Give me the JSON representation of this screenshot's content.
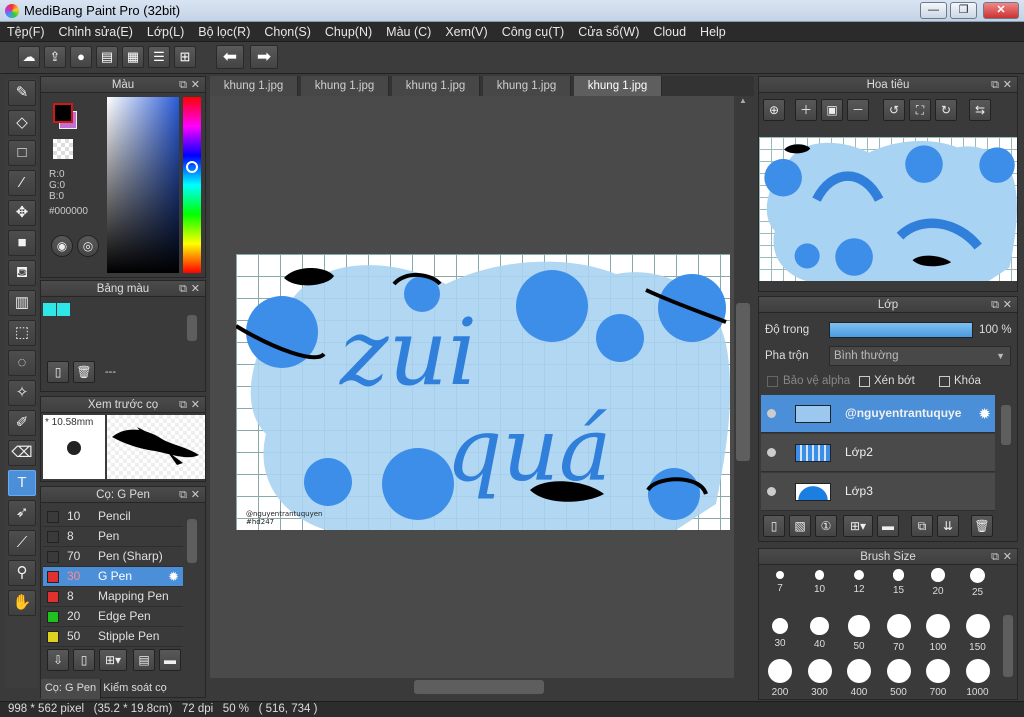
{
  "window": {
    "title": "MediBang Paint Pro (32bit)",
    "minimize": "—",
    "restore": "❐",
    "close": "✕"
  },
  "menu": [
    "Tệp(F)",
    "Chỉnh sửa(E)",
    "Lớp(L)",
    "Bộ lọc(R)",
    "Chọn(S)",
    "Chụp(N)",
    "Màu (C)",
    "Xem(V)",
    "Công cụ(T)",
    "Cửa sổ(W)",
    "Cloud",
    "Help"
  ],
  "tabs": [
    "khung 1.jpg",
    "khung 1.jpg",
    "khung 1.jpg",
    "khung 1.jpg",
    "khung 1.jpg"
  ],
  "active_tab": 4,
  "color_panel": {
    "title": "Màu",
    "r": "R:0",
    "g": "G:0",
    "b": "B:0",
    "hex": "#000000",
    "fg": "#000000",
    "bg": "#c070d0"
  },
  "palette_panel": {
    "title": "Bảng màu",
    "value": "---"
  },
  "preview_panel": {
    "title": "Xem trước cọ",
    "size": "* 10.58mm"
  },
  "brush_panel": {
    "title": "Cọ: G Pen",
    "items": [
      {
        "size": "10",
        "name": "Pencil",
        "color": "#3a3a3a"
      },
      {
        "size": "8",
        "name": "Pen",
        "color": "#3a3a3a"
      },
      {
        "size": "70",
        "name": "Pen (Sharp)",
        "color": "#3a3a3a"
      },
      {
        "size": "30",
        "name": "G Pen",
        "color": "#e03030"
      },
      {
        "size": "8",
        "name": "Mapping Pen",
        "color": "#e03030"
      },
      {
        "size": "20",
        "name": "Edge Pen",
        "color": "#20c020"
      },
      {
        "size": "50",
        "name": "Stipple Pen",
        "color": "#e0d020"
      }
    ],
    "selected": 3,
    "tab1": "Cọ: G Pen",
    "tab2": "Kiểm soát cọ"
  },
  "navigator": {
    "title": "Hoa tiêu"
  },
  "layer_panel": {
    "title": "Lớp",
    "opacity_label": "Độ trong",
    "opacity_value": "100 %",
    "opacity_fraction": 1.0,
    "blend_label": "Pha trộn",
    "blend_value": "Bình thường",
    "protect_alpha": "Bảo vệ alpha",
    "clipping": "Xén bớt",
    "lock": "Khóa",
    "layers": [
      {
        "name": "@nguyentrantuquye"
      },
      {
        "name": "Lớp2"
      },
      {
        "name": "Lớp3"
      }
    ]
  },
  "brush_size": {
    "title": "Brush Size",
    "sizes": [
      "7",
      "10",
      "12",
      "15",
      "20",
      "25",
      "30",
      "40",
      "50",
      "70",
      "100",
      "150",
      "200",
      "300",
      "400",
      "500",
      "700",
      "1000"
    ]
  },
  "artwork": {
    "line1": "zui",
    "line2": "quá",
    "signature1": "@nguyentrantuquyen",
    "signature2": "#hd247"
  },
  "status": "998 * 562 pixel   (35.2 * 19.8cm)   72 dpi   50 %   ( 516, 734 )"
}
